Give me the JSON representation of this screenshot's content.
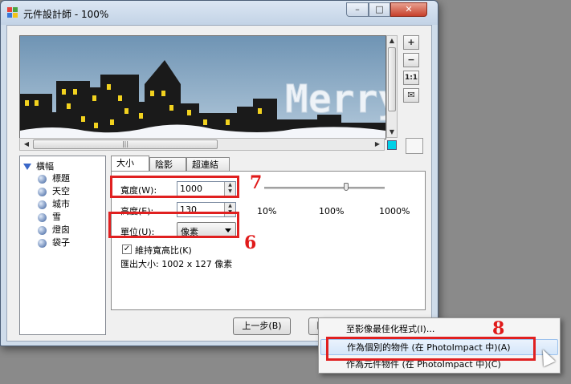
{
  "window": {
    "title": "元件設計師 - 100%",
    "controls": {
      "minimize": "–",
      "maximize": "□",
      "close": "✕"
    }
  },
  "preview": {
    "text": "Merry"
  },
  "toolbar": {
    "zoom_in": "+",
    "zoom_out": "−",
    "actual_size": "1:1",
    "mail": "✉"
  },
  "tree": {
    "root": "橫幅",
    "items": [
      "標題",
      "天空",
      "城市",
      "雪",
      "燈囪",
      "袋子"
    ]
  },
  "tabs": [
    "大小",
    "陰影",
    "超連結"
  ],
  "size_panel": {
    "width_label": "寬度(W):",
    "width_value": "1000",
    "height_label": "高度(E):",
    "height_value": "130",
    "unit_label": "單位(U):",
    "unit_value": "像素",
    "keep_ratio_label": "維持寬高比(K)",
    "keep_ratio_checked": true,
    "export_size": "匯出大小: 1002 x 127 像素",
    "slider_labels": [
      "10%",
      "100%",
      "1000%"
    ],
    "slider_level": 0.68
  },
  "buttons": {
    "prev": "上一步(B)",
    "next": "匯"
  },
  "annotations": {
    "n6": "6",
    "n7": "7",
    "n8": "8"
  },
  "context_menu": {
    "items": [
      "至影像最佳化程式(I)...",
      "作為個別的物件 (在 PhotoImpact 中)(A)",
      "作為元件物件 (在 PhotoImpact 中)(C)"
    ],
    "highlighted_index": 1
  },
  "colors": {
    "accent_red": "#e02020",
    "sky_top": "#7fa0bd",
    "window_yellow": "#f2d21f"
  }
}
